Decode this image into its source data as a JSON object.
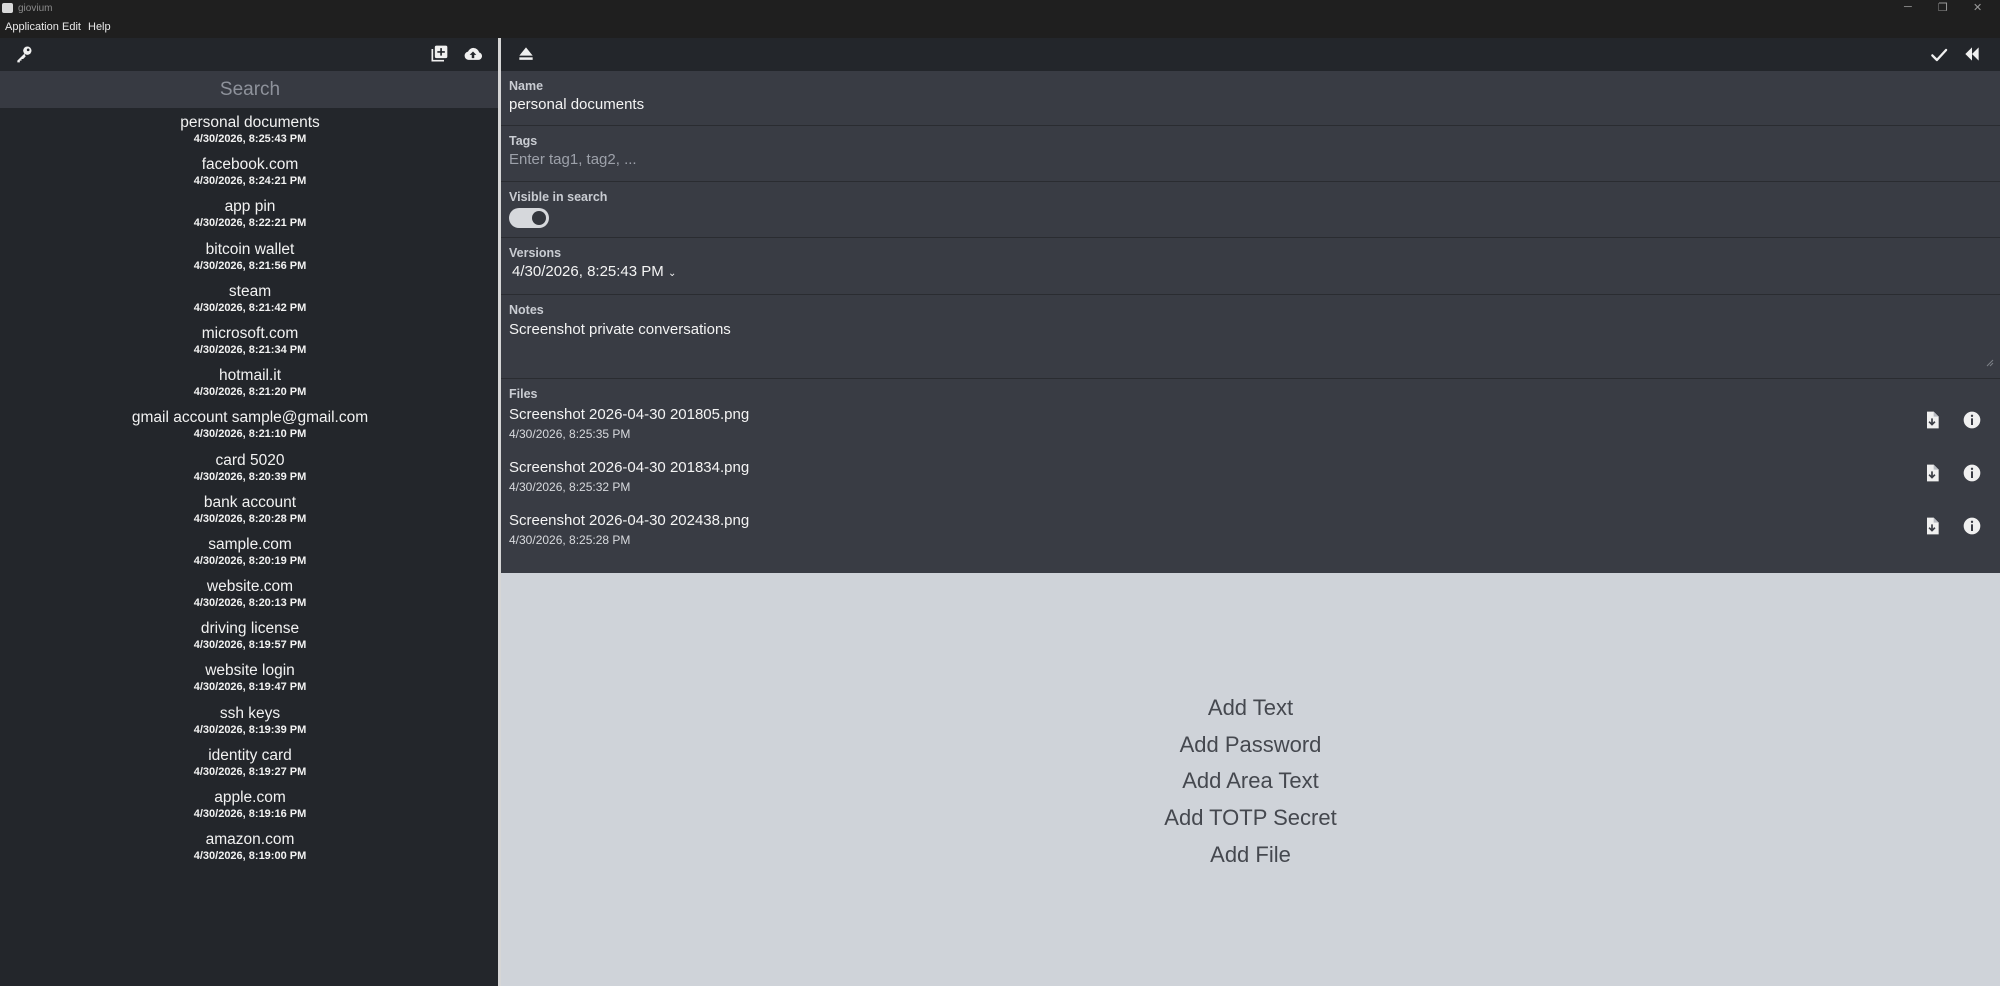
{
  "window": {
    "title": "giovium",
    "minimize": "─",
    "maximize": "❐",
    "close": "✕"
  },
  "menu": [
    "Application",
    "Edit",
    "Help"
  ],
  "search": {
    "placeholder": "Search"
  },
  "entries": [
    {
      "name": "personal documents",
      "date": "4/30/2026, 8:25:43 PM"
    },
    {
      "name": "facebook.com",
      "date": "4/30/2026, 8:24:21 PM"
    },
    {
      "name": "app pin",
      "date": "4/30/2026, 8:22:21 PM"
    },
    {
      "name": "bitcoin wallet",
      "date": "4/30/2026, 8:21:56 PM"
    },
    {
      "name": "steam",
      "date": "4/30/2026, 8:21:42 PM"
    },
    {
      "name": "microsoft.com",
      "date": "4/30/2026, 8:21:34 PM"
    },
    {
      "name": "hotmail.it",
      "date": "4/30/2026, 8:21:20 PM"
    },
    {
      "name": "gmail account sample@gmail.com",
      "date": "4/30/2026, 8:21:10 PM"
    },
    {
      "name": "card 5020",
      "date": "4/30/2026, 8:20:39 PM"
    },
    {
      "name": "bank account",
      "date": "4/30/2026, 8:20:28 PM"
    },
    {
      "name": "sample.com",
      "date": "4/30/2026, 8:20:19 PM"
    },
    {
      "name": "website.com",
      "date": "4/30/2026, 8:20:13 PM"
    },
    {
      "name": "driving license",
      "date": "4/30/2026, 8:19:57 PM"
    },
    {
      "name": "website login",
      "date": "4/30/2026, 8:19:47 PM"
    },
    {
      "name": "ssh keys",
      "date": "4/30/2026, 8:19:39 PM"
    },
    {
      "name": "identity card",
      "date": "4/30/2026, 8:19:27 PM"
    },
    {
      "name": "apple.com",
      "date": "4/30/2026, 8:19:16 PM"
    },
    {
      "name": "amazon.com",
      "date": "4/30/2026, 8:19:00 PM"
    }
  ],
  "detail": {
    "name_label": "Name",
    "name_value": "personal documents",
    "tags_label": "Tags",
    "tags_placeholder": "Enter tag1, tag2, ...",
    "visible_label": "Visible in search",
    "visible_on": true,
    "versions_label": "Versions",
    "versions_value": "4/30/2026, 8:25:43 PM",
    "notes_label": "Notes",
    "notes_value": "Screenshot private conversations",
    "files_label": "Files",
    "files": [
      {
        "name": "Screenshot 2026-04-30 201805.png",
        "date": "4/30/2026, 8:25:35 PM"
      },
      {
        "name": "Screenshot 2026-04-30 201834.png",
        "date": "4/30/2026, 8:25:32 PM"
      },
      {
        "name": "Screenshot 2026-04-30 202438.png",
        "date": "4/30/2026, 8:25:28 PM"
      }
    ]
  },
  "add_actions": [
    "Add Text",
    "Add Password",
    "Add Area Text",
    "Add TOTP Secret",
    "Add File"
  ],
  "colors": {
    "panel_dark": "#23262b",
    "field_bg": "#393c44",
    "content_light": "#cfd3d9",
    "search_bg": "#373a42"
  }
}
